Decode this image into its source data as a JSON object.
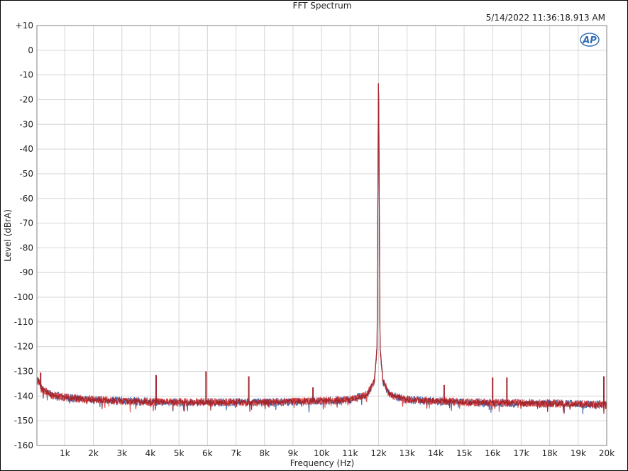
{
  "chart_data": {
    "type": "line",
    "title": "FFT Spectrum",
    "timestamp": "5/14/2022 11:36:18.913 AM",
    "logo_text": "AP",
    "xlabel": "Frequency (Hz)",
    "ylabel": "Level (dBrA)",
    "xlim": [
      20,
      20000
    ],
    "ylim": [
      -160,
      10
    ],
    "x_ticks": [
      {
        "value": 1000,
        "label": "1k"
      },
      {
        "value": 2000,
        "label": "2k"
      },
      {
        "value": 3000,
        "label": "3k"
      },
      {
        "value": 4000,
        "label": "4k"
      },
      {
        "value": 5000,
        "label": "5k"
      },
      {
        "value": 6000,
        "label": "6k"
      },
      {
        "value": 7000,
        "label": "7k"
      },
      {
        "value": 8000,
        "label": "8k"
      },
      {
        "value": 9000,
        "label": "9k"
      },
      {
        "value": 10000,
        "label": "10k"
      },
      {
        "value": 11000,
        "label": "11k"
      },
      {
        "value": 12000,
        "label": "12k"
      },
      {
        "value": 13000,
        "label": "13k"
      },
      {
        "value": 14000,
        "label": "14k"
      },
      {
        "value": 15000,
        "label": "15k"
      },
      {
        "value": 16000,
        "label": "16k"
      },
      {
        "value": 17000,
        "label": "17k"
      },
      {
        "value": 18000,
        "label": "18k"
      },
      {
        "value": 19000,
        "label": "19k"
      },
      {
        "value": 20000,
        "label": "20k"
      }
    ],
    "y_ticks": [
      {
        "value": 10,
        "label": "+10"
      },
      {
        "value": 0,
        "label": "0"
      },
      {
        "value": -10,
        "label": "-10"
      },
      {
        "value": -20,
        "label": "-20"
      },
      {
        "value": -30,
        "label": "-30"
      },
      {
        "value": -40,
        "label": "-40"
      },
      {
        "value": -50,
        "label": "-50"
      },
      {
        "value": -60,
        "label": "-60"
      },
      {
        "value": -70,
        "label": "-70"
      },
      {
        "value": -80,
        "label": "-80"
      },
      {
        "value": -90,
        "label": "-90"
      },
      {
        "value": -100,
        "label": "-100"
      },
      {
        "value": -110,
        "label": "-110"
      },
      {
        "value": -120,
        "label": "-120"
      },
      {
        "value": -130,
        "label": "-130"
      },
      {
        "value": -140,
        "label": "-140"
      },
      {
        "value": -150,
        "label": "-150"
      },
      {
        "value": -160,
        "label": "-160"
      }
    ],
    "grid": true,
    "legend": "none",
    "noise_floor": [
      [
        20,
        -133
      ],
      [
        200,
        -137
      ],
      [
        500,
        -139.5
      ],
      [
        1000,
        -140.5
      ],
      [
        2000,
        -141.5
      ],
      [
        3000,
        -142
      ],
      [
        5000,
        -142.5
      ],
      [
        8000,
        -142.5
      ],
      [
        10000,
        -142
      ],
      [
        11000,
        -141.5
      ],
      [
        11600,
        -139.5
      ],
      [
        11850,
        -134
      ],
      [
        11950,
        -120
      ],
      [
        12000,
        -3
      ],
      [
        12050,
        -120
      ],
      [
        12150,
        -134
      ],
      [
        12400,
        -139.5
      ],
      [
        13000,
        -141.5
      ],
      [
        15000,
        -142.5
      ],
      [
        18000,
        -143
      ],
      [
        20000,
        -143.5
      ]
    ],
    "spurs": [
      {
        "x": 150,
        "y": -130.5
      },
      {
        "x": 4200,
        "y": -131.5
      },
      {
        "x": 5950,
        "y": -130
      },
      {
        "x": 7450,
        "y": -132
      },
      {
        "x": 9700,
        "y": -136.5
      },
      {
        "x": 14300,
        "y": -135.5
      },
      {
        "x": 16000,
        "y": -132.5
      },
      {
        "x": 16500,
        "y": -132.5
      },
      {
        "x": 19900,
        "y": -132
      }
    ],
    "series": [
      {
        "color": "#3a66b0",
        "noise_amplitude": 1.6,
        "seed": 7
      },
      {
        "color": "#e0524e",
        "noise_amplitude": 1.6,
        "seed": 13
      },
      {
        "color": "#a3262e",
        "noise_amplitude": 1.1,
        "seed": 29
      }
    ],
    "colors": {
      "grid": "#d6d6d6",
      "axis": "#808080",
      "logo": "#2f6db5"
    }
  }
}
